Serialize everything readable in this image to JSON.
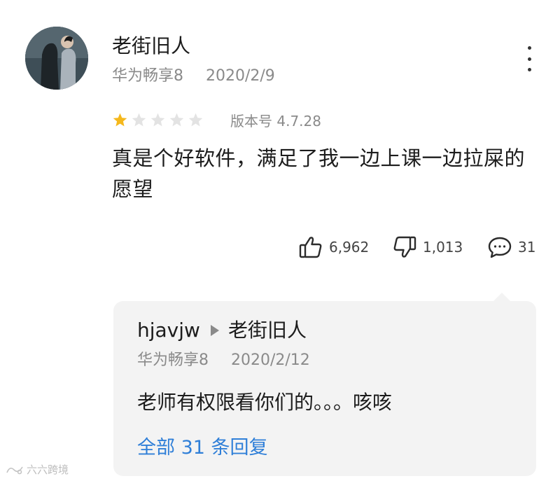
{
  "review": {
    "user": {
      "name": "老街旧人",
      "device": "华为畅享8",
      "date": "2020/2/9"
    },
    "rating": {
      "value": 1,
      "max": 5,
      "filled_color": "#f5b81c",
      "empty_color": "#e3e3e3"
    },
    "version_label": "版本号 4.7.28",
    "text": "真是个好软件，满足了我一边上课一边拉屎的愿望",
    "actions": {
      "likes": "6,962",
      "dislikes": "1,013",
      "comments": "31",
      "icons": [
        "thumbs-up-icon",
        "thumbs-down-icon",
        "comment-icon"
      ]
    },
    "more_icon": "more-vertical-icon"
  },
  "reply": {
    "author": "hjavjw",
    "reply_to": "老街旧人",
    "device": "华为畅享8",
    "date": "2020/2/12",
    "text": "老师有权限看你们的。。。咳咳",
    "all_replies_label": "全部 31 条回复",
    "link_color": "#2f7fd8"
  },
  "watermark": {
    "text": "六六跨境"
  }
}
